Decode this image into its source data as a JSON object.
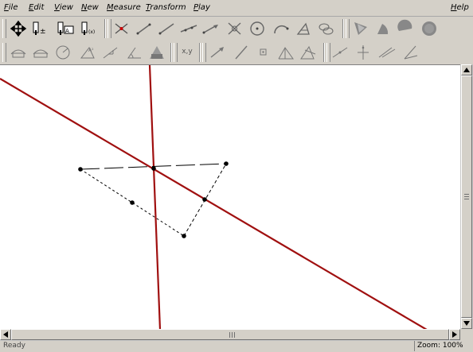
{
  "menu": {
    "file": {
      "accel": "F",
      "rest": "ile"
    },
    "edit": {
      "accel": "E",
      "rest": "dit"
    },
    "view": {
      "accel": "V",
      "rest": "iew"
    },
    "new": {
      "accel": "N",
      "rest": "ew"
    },
    "measure": {
      "accel": "M",
      "rest": "easure"
    },
    "transform": {
      "accel": "T",
      "rest": "ransform"
    },
    "play": {
      "accel": "P",
      "rest": "lay"
    },
    "help": {
      "accel": "H",
      "rest": "elp"
    }
  },
  "toolbar_row2": {
    "xy_label": "x,y"
  },
  "status": {
    "message": "Ready",
    "zoom_label": "Zoom: 100%"
  },
  "colors": {
    "line": "#a01010",
    "background": "#d4d0c8",
    "canvas": "#ffffff"
  },
  "icons": {
    "row1": [
      "move-icon",
      "point-plus-icon",
      "point-label-icon",
      "point-coordinates-icon",
      "intersection-icon",
      "segment-icon",
      "ray-icon",
      "line-icon",
      "vector-icon",
      "midpoint-icon",
      "circle-icon",
      "arc-icon",
      "polygon-icon",
      "conic-icon",
      "fill-polygon-icon",
      "fill-sector-icon",
      "fill-segment-icon",
      "fill-circle-icon"
    ],
    "row2": [
      "measure-distance-icon",
      "measure-length-icon",
      "measure-radius-icon",
      "measure-area-icon",
      "measure-slope-icon",
      "measure-angle-icon",
      "measure-figure-icon",
      "coordinates-icon",
      "translate-icon",
      "reflect-icon",
      "rotate-icon",
      "dilate-icon",
      "locus-icon",
      "perpendicular-icon",
      "parallel-icon",
      "bisector-icon",
      "tangent-icon"
    ]
  }
}
